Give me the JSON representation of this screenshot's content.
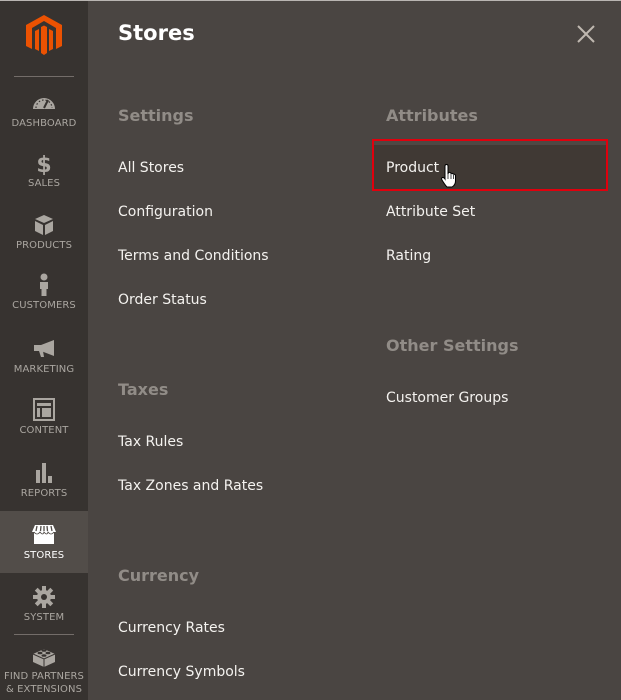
{
  "sidebar": {
    "logo": "magento-logo",
    "items": [
      {
        "label": "DASHBOARD",
        "icon": "dashboard-icon",
        "active": false
      },
      {
        "label": "SALES",
        "icon": "dollar-icon",
        "active": false
      },
      {
        "label": "PRODUCTS",
        "icon": "box-icon",
        "active": false
      },
      {
        "label": "CUSTOMERS",
        "icon": "person-icon",
        "active": false
      },
      {
        "label": "MARKETING",
        "icon": "megaphone-icon",
        "active": false
      },
      {
        "label": "CONTENT",
        "icon": "layout-icon",
        "active": false
      },
      {
        "label": "REPORTS",
        "icon": "bar-chart-icon",
        "active": false
      },
      {
        "label": "STORES",
        "icon": "storefront-icon",
        "active": true
      },
      {
        "label": "SYSTEM",
        "icon": "gear-icon",
        "active": false
      },
      {
        "label_line1": "FIND PARTNERS",
        "label_line2": "& EXTENSIONS",
        "icon": "lego-brick-icon",
        "active": false
      }
    ]
  },
  "panel": {
    "title": "Stores",
    "close_icon": "close-icon",
    "sections": [
      {
        "title": "Settings",
        "items": [
          "All Stores",
          "Configuration",
          "Terms and Conditions",
          "Order Status"
        ]
      },
      {
        "title": "Taxes",
        "items": [
          "Tax Rules",
          "Tax Zones and Rates"
        ]
      },
      {
        "title": "Currency",
        "items": [
          "Currency Rates",
          "Currency Symbols"
        ]
      },
      {
        "title": "Attributes",
        "items": [
          "Product",
          "Attribute Set",
          "Rating"
        ]
      },
      {
        "title": "Other Settings",
        "items": [
          "Customer Groups"
        ]
      }
    ],
    "highlighted_item": "Product"
  },
  "colors": {
    "brand": "#eb5202",
    "highlight_border": "#e0000d",
    "panel_bg": "#4a4542",
    "sidebar_bg": "#373330"
  }
}
